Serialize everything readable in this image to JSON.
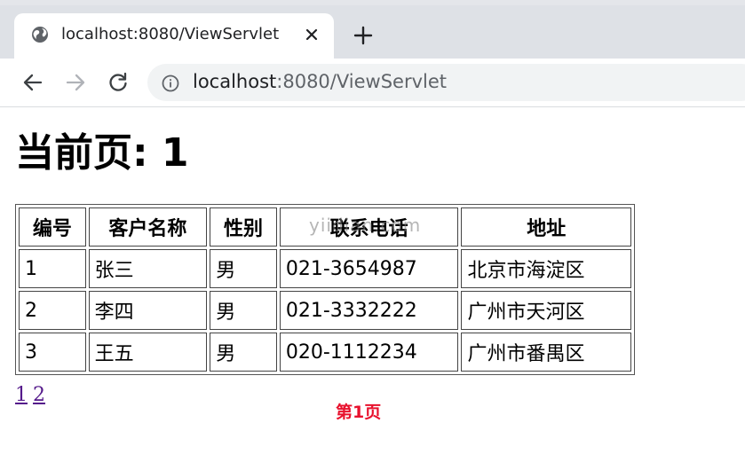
{
  "browser": {
    "tab": {
      "title": "localhost:8080/ViewServlet",
      "favicon": "globe-icon",
      "close_icon": "close-icon"
    },
    "new_tab_icon": "plus-icon",
    "nav": {
      "back_icon": "arrow-left-icon",
      "forward_icon": "arrow-right-icon",
      "reload_icon": "reload-icon"
    },
    "address": {
      "info_icon": "info-icon",
      "host": "localhost",
      "path": ":8080/ViewServlet"
    }
  },
  "page": {
    "heading": "当前页: 1",
    "table": {
      "headers": [
        "编号",
        "客户名称",
        "性别",
        "联系电话",
        "地址"
      ],
      "rows": [
        [
          "1",
          "张三",
          "男",
          "021-3654987",
          "北京市海淀区"
        ],
        [
          "2",
          "李四",
          "男",
          "021-3332222",
          "广州市天河区"
        ],
        [
          "3",
          "王五",
          "男",
          "020-1112234",
          "广州市番禺区"
        ]
      ]
    },
    "watermark": "yiidian.com",
    "pagination": {
      "links": [
        "1",
        "2"
      ],
      "current_label": "第1页"
    }
  },
  "colors": {
    "tabstrip": "#dee1e6",
    "omnibox": "#f1f3f4",
    "link_visited": "#551a8b",
    "current_page": "#e8112d"
  }
}
